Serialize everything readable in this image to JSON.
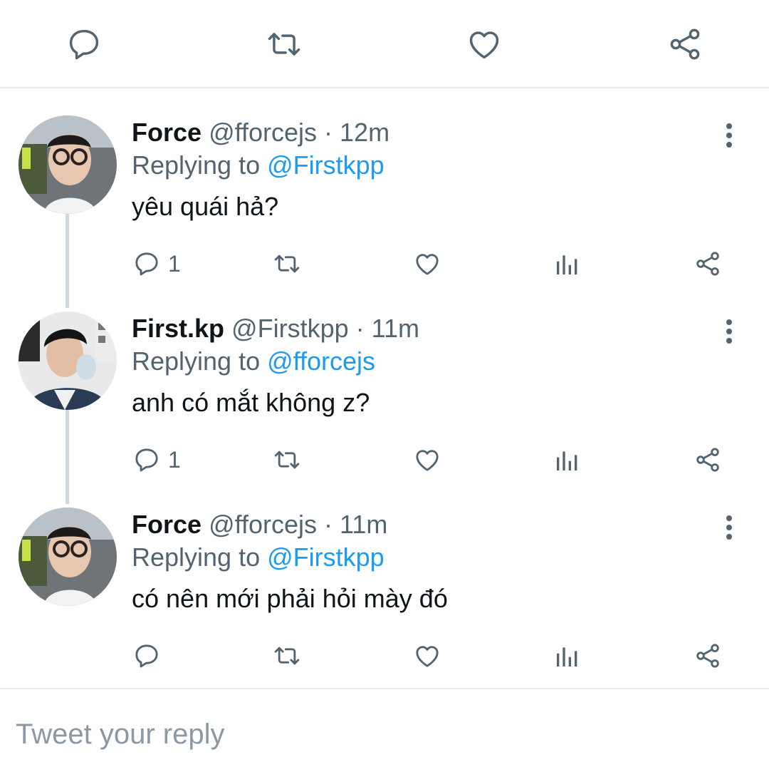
{
  "top_actions": [
    {
      "name": "reply-icon",
      "label": "Reply"
    },
    {
      "name": "retweet-icon",
      "label": "Retweet"
    },
    {
      "name": "like-icon",
      "label": "Like"
    },
    {
      "name": "share-icon",
      "label": "Share"
    }
  ],
  "colors": {
    "text": "#0f1419",
    "secondary": "#536471",
    "link": "#1d9bf0",
    "divider": "#e6ecf0",
    "thread_line": "#cfd9de"
  },
  "tweets": [
    {
      "name": "Force",
      "handle": "@fforcejs",
      "dot": "·",
      "time": "12m",
      "replying_prefix": "Replying to ",
      "replying_to": "@Firstkpp",
      "text": "yêu quái hả?",
      "reply_count": "1",
      "avatar": "avatar-force"
    },
    {
      "name": "First.kp",
      "handle": "@Firstkpp",
      "dot": "·",
      "time": "11m",
      "replying_prefix": "Replying to ",
      "replying_to": "@fforcejs",
      "text": "anh có mắt không z?",
      "reply_count": "1",
      "avatar": "avatar-firstkp"
    },
    {
      "name": "Force",
      "handle": "@fforcejs",
      "dot": "·",
      "time": "11m",
      "replying_prefix": "Replying to ",
      "replying_to": "@Firstkpp",
      "text": "có nên mới phải hỏi mày đó",
      "reply_count": "",
      "avatar": "avatar-force"
    }
  ],
  "composer": {
    "placeholder": "Tweet your reply"
  }
}
